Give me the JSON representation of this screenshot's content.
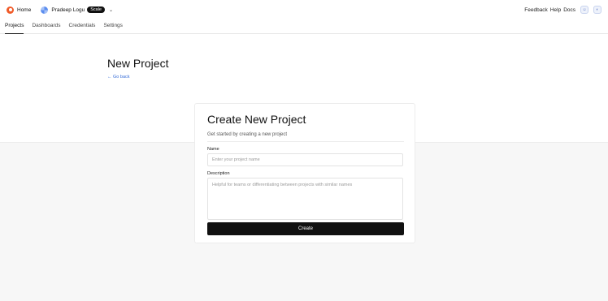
{
  "header": {
    "home_label": "Home",
    "org_name": "Pradeep Logu",
    "plan_badge": "Scale",
    "links": [
      "Feedback",
      "Help",
      "Docs"
    ]
  },
  "tabs": [
    {
      "label": "Projects",
      "active": true
    },
    {
      "label": "Dashboards",
      "active": false
    },
    {
      "label": "Credentials",
      "active": false
    },
    {
      "label": "Settings",
      "active": false
    }
  ],
  "page": {
    "title": "New Project",
    "back_link": "← Go back"
  },
  "form": {
    "title": "Create New Project",
    "subtitle": "Get started by creating a new project",
    "name_label": "Name",
    "name_placeholder": "Enter your project name",
    "name_value": "",
    "description_label": "Description",
    "description_placeholder": "Helpful for teams or differentiating between projects with similar names",
    "description_value": "",
    "submit_label": "Create"
  },
  "colors": {
    "brand": "#f05a28",
    "link": "#3a6fd8",
    "button": "#111111"
  }
}
